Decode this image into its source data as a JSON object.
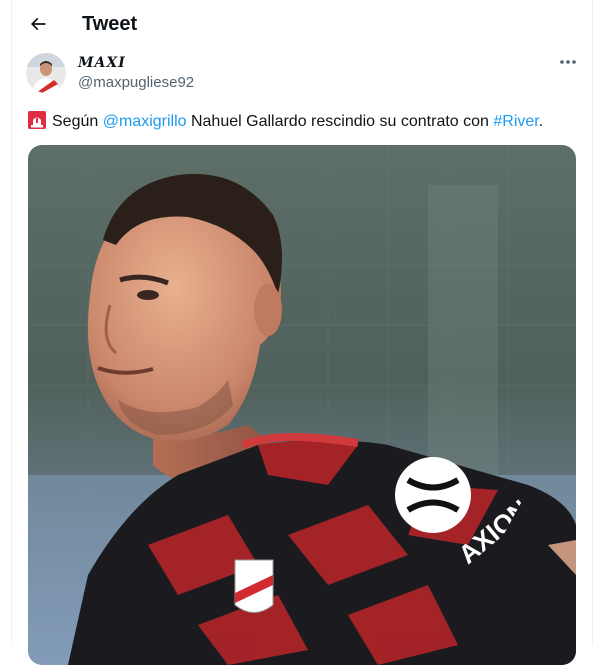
{
  "header": {
    "title": "Tweet",
    "back_icon": "arrow-left-icon"
  },
  "author": {
    "name": "MAXI",
    "handle": "@maxpugliese92"
  },
  "tweet": {
    "emoji": "rotating-light-icon",
    "text_1": "Según ",
    "mention": "@maxigrillo",
    "text_2": " Nahuel Gallardo rescindio su contrato con ",
    "hashtag": "#River",
    "text_3": "."
  },
  "media": {
    "sponsor_text": "AXION",
    "alt": "Photo of a footballer wearing a red and black River Plate jersey"
  },
  "colors": {
    "link": "#1d9bf0",
    "secondary_text": "#536471"
  }
}
